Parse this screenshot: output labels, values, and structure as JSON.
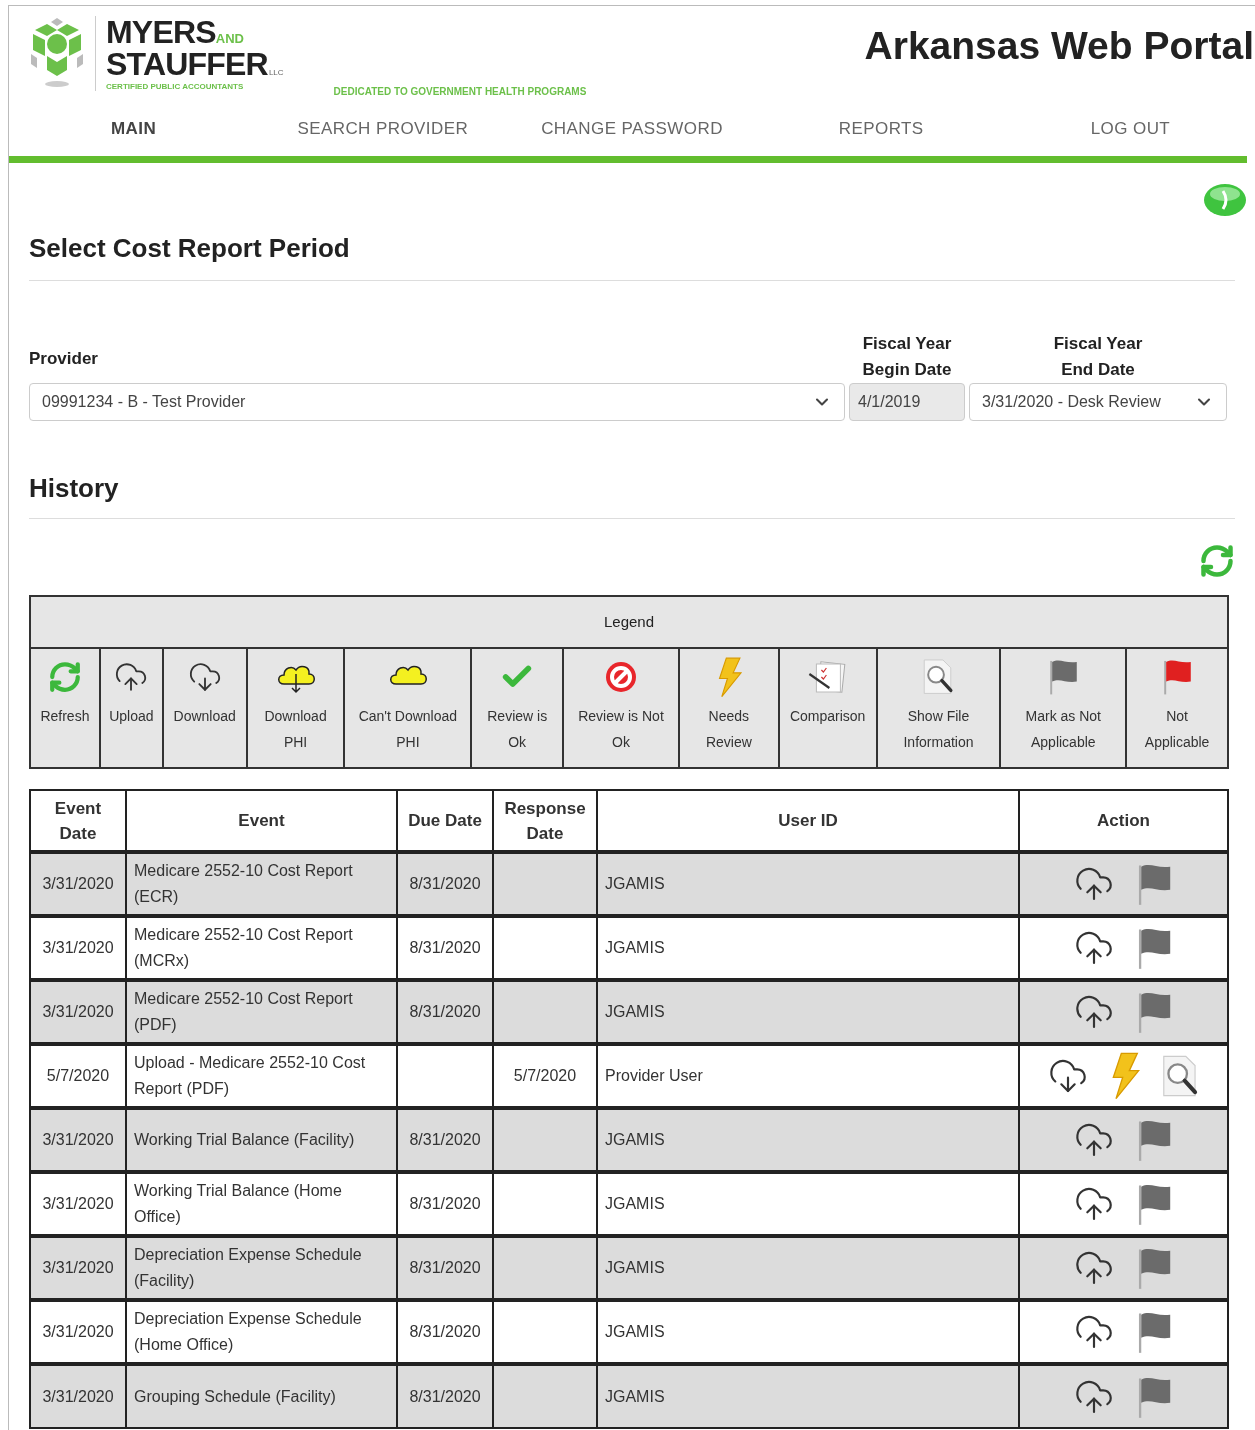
{
  "header": {
    "logo": {
      "line1": "MYERS",
      "and": "AND",
      "line2": "STAUFFER",
      "llc": "LLC",
      "tagline": "CERTIFIED PUBLIC ACCOUNTANTS"
    },
    "slogan": "DEDICATED TO GOVERNMENT HEALTH PROGRAMS",
    "portal_title": "Arkansas Web Portal"
  },
  "nav": [
    {
      "label": "MAIN",
      "selected": true
    },
    {
      "label": "SEARCH PROVIDER",
      "selected": false
    },
    {
      "label": "CHANGE PASSWORD",
      "selected": false
    },
    {
      "label": "REPORTS",
      "selected": false
    },
    {
      "label": "LOG OUT",
      "selected": false
    }
  ],
  "period": {
    "title": "Select Cost Report Period",
    "provider_label": "Provider",
    "provider_value": "09991234 - B - Test Provider",
    "begin_label_1": "Fiscal Year",
    "begin_label_2": "Begin Date",
    "begin_value": "4/1/2019",
    "end_label_1": "Fiscal Year",
    "end_label_2": "End Date",
    "end_value": "3/31/2020 - Desk Review"
  },
  "history": {
    "title": "History",
    "legend_title": "Legend",
    "legend": [
      {
        "kind": "refresh",
        "label_1": "Refresh"
      },
      {
        "kind": "upload",
        "label_1": "Upload"
      },
      {
        "kind": "download",
        "label_1": "Download"
      },
      {
        "kind": "download_phi",
        "label_1": "Download",
        "label_2": "PHI"
      },
      {
        "kind": "cant_download_phi",
        "label_1": "Can't Download",
        "label_2": "PHI"
      },
      {
        "kind": "review_ok",
        "label_1": "Review is",
        "label_2": "Ok"
      },
      {
        "kind": "review_not_ok",
        "label_1": "Review is Not",
        "label_2": "Ok"
      },
      {
        "kind": "needs_review",
        "label_1": "Needs",
        "label_2": "Review"
      },
      {
        "kind": "comparison",
        "label_1": "Comparison"
      },
      {
        "kind": "file_info",
        "label_1": "Show File",
        "label_2": "Information"
      },
      {
        "kind": "mark_na",
        "label_1": "Mark as Not",
        "label_2": "Applicable"
      },
      {
        "kind": "not_applicable",
        "label_1": "Not",
        "label_2": "Applicable"
      }
    ],
    "columns": [
      "Event Date",
      "Event",
      "Due Date",
      "Response Date",
      "User ID",
      "Action"
    ],
    "rows": [
      {
        "event_date": "3/31/2020",
        "event": "Medicare 2552-10 Cost Report (ECR)",
        "due_date": "8/31/2020",
        "user_id": "JGAMIS",
        "actions": [
          {
            "kind": "upload"
          },
          {
            "kind": "mark_na"
          }
        ]
      },
      {
        "event_date": "3/31/2020",
        "event": "Medicare 2552-10 Cost Report (MCRx)",
        "due_date": "8/31/2020",
        "user_id": "JGAMIS",
        "actions": [
          {
            "kind": "upload"
          },
          {
            "kind": "mark_na"
          }
        ]
      },
      {
        "event_date": "3/31/2020",
        "event": "Medicare 2552-10 Cost Report (PDF)",
        "due_date": "8/31/2020",
        "user_id": "JGAMIS",
        "actions": [
          {
            "kind": "upload"
          },
          {
            "kind": "mark_na"
          }
        ]
      },
      {
        "event_date": "5/7/2020",
        "event": "Upload - Medicare 2552-10 Cost Report (PDF)",
        "response_date": "5/7/2020",
        "user_id": "Provider User",
        "actions": [
          {
            "kind": "download"
          },
          {
            "kind": "needs_review"
          },
          {
            "kind": "file_info"
          }
        ]
      },
      {
        "event_date": "3/31/2020",
        "event": "Working Trial Balance (Facility)",
        "due_date": "8/31/2020",
        "user_id": "JGAMIS",
        "actions": [
          {
            "kind": "upload"
          },
          {
            "kind": "mark_na"
          }
        ]
      },
      {
        "event_date": "3/31/2020",
        "event": "Working Trial Balance (Home Office)",
        "due_date": "8/31/2020",
        "user_id": "JGAMIS",
        "actions": [
          {
            "kind": "upload"
          },
          {
            "kind": "mark_na"
          }
        ]
      },
      {
        "event_date": "3/31/2020",
        "event": "Depreciation Expense Schedule (Facility)",
        "due_date": "8/31/2020",
        "user_id": "JGAMIS",
        "actions": [
          {
            "kind": "upload"
          },
          {
            "kind": "mark_na"
          }
        ]
      },
      {
        "event_date": "3/31/2020",
        "event": "Depreciation Expense Schedule (Home Office)",
        "due_date": "8/31/2020",
        "user_id": "JGAMIS",
        "actions": [
          {
            "kind": "upload"
          },
          {
            "kind": "mark_na"
          }
        ]
      },
      {
        "event_date": "3/31/2020",
        "event": "Grouping Schedule (Facility)",
        "due_date": "8/31/2020",
        "user_id": "JGAMIS",
        "actions": [
          {
            "kind": "upload"
          },
          {
            "kind": "mark_na"
          }
        ]
      }
    ]
  }
}
